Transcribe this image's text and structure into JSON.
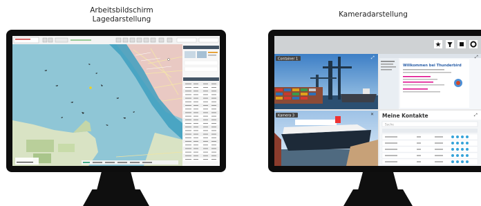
{
  "left": {
    "caption_line1": "Arbeitsbildschirm",
    "caption_line2": "Lagedarstellung"
  },
  "right": {
    "caption": "Kameradarstellung",
    "pane_label_tl": "Container 1",
    "pane_label_bl": "Kamera 3",
    "contacts_title": "Meine Kontakte",
    "welcome_title": "Willkommen bei Thunderbird",
    "search_placeholder": "Suche"
  },
  "colors": {
    "water": "#8fc6d6",
    "fairway": "#3e9fc0",
    "land": "#d9e3c4",
    "city": "#e9c9c3",
    "frame": "#0d0d0d"
  }
}
